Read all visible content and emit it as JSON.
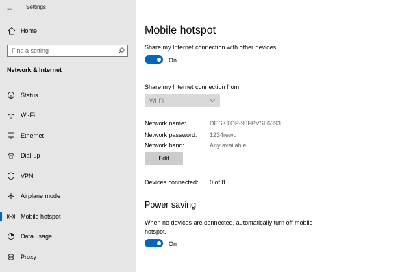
{
  "app": {
    "title": "Settings"
  },
  "sidebar": {
    "home_label": "Home",
    "search_placeholder": "Find a setting",
    "section_title": "Network & Internet",
    "items": [
      {
        "label": "Status",
        "icon": "status-icon"
      },
      {
        "label": "Wi-Fi",
        "icon": "wifi-icon"
      },
      {
        "label": "Ethernet",
        "icon": "ethernet-icon"
      },
      {
        "label": "Dial-up",
        "icon": "dialup-icon"
      },
      {
        "label": "VPN",
        "icon": "vpn-icon"
      },
      {
        "label": "Airplane mode",
        "icon": "airplane-icon"
      },
      {
        "label": "Mobile hotspot",
        "icon": "hotspot-icon",
        "active": true
      },
      {
        "label": "Data usage",
        "icon": "data-usage-icon"
      },
      {
        "label": "Proxy",
        "icon": "proxy-icon"
      }
    ]
  },
  "main": {
    "title": "Mobile hotspot",
    "share_label": "Share my Internet connection with other devices",
    "share_toggle_state": "On",
    "share_from_label": "Share my Internet connection from",
    "share_from_value": "Wi-Fi",
    "network_name_label": "Network name:",
    "network_name_value": "DESKTOP-9JFPVSI 6393",
    "network_password_label": "Network password:",
    "network_password_value": "1234rewq",
    "network_band_label": "Network band:",
    "network_band_value": "Any available",
    "edit_label": "Edit",
    "devices_label": "Devices connected:",
    "devices_value": "0 of 8",
    "power_heading": "Power saving",
    "power_text_line1": "When no devices are connected, automatically turn off mobile",
    "power_text_line2": "hotspot.",
    "power_toggle_state": "On"
  },
  "colors": {
    "accent": "#0067c0",
    "sidebar_bg": "#e6e6e6"
  }
}
